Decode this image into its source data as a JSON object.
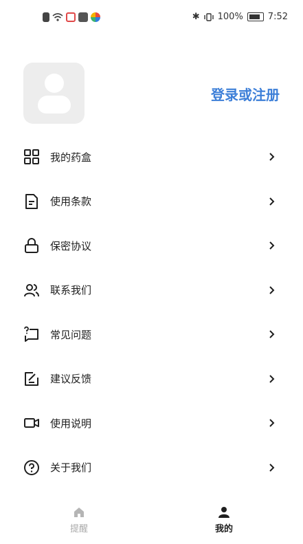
{
  "status_bar": {
    "battery_percent": "100%",
    "time": "7:52"
  },
  "profile": {
    "login_label": "登录或注册"
  },
  "menu": [
    {
      "label": "我的药盒",
      "icon": "grid-icon"
    },
    {
      "label": "使用条款",
      "icon": "document-icon"
    },
    {
      "label": "保密协议",
      "icon": "lock-icon"
    },
    {
      "label": "联系我们",
      "icon": "contacts-icon"
    },
    {
      "label": "常见问题",
      "icon": "question-chat-icon"
    },
    {
      "label": "建议反馈",
      "icon": "edit-feedback-icon"
    },
    {
      "label": "使用说明",
      "icon": "video-icon"
    },
    {
      "label": "关于我们",
      "icon": "help-circle-icon"
    }
  ],
  "bottom_nav": {
    "tabs": [
      {
        "label": "提醒",
        "icon": "home-icon",
        "active": false
      },
      {
        "label": "我的",
        "icon": "person-icon",
        "active": true
      }
    ]
  },
  "colors": {
    "accent": "#3d7fd8",
    "text": "#1f1f1f",
    "inactive": "#a9a9a9"
  }
}
